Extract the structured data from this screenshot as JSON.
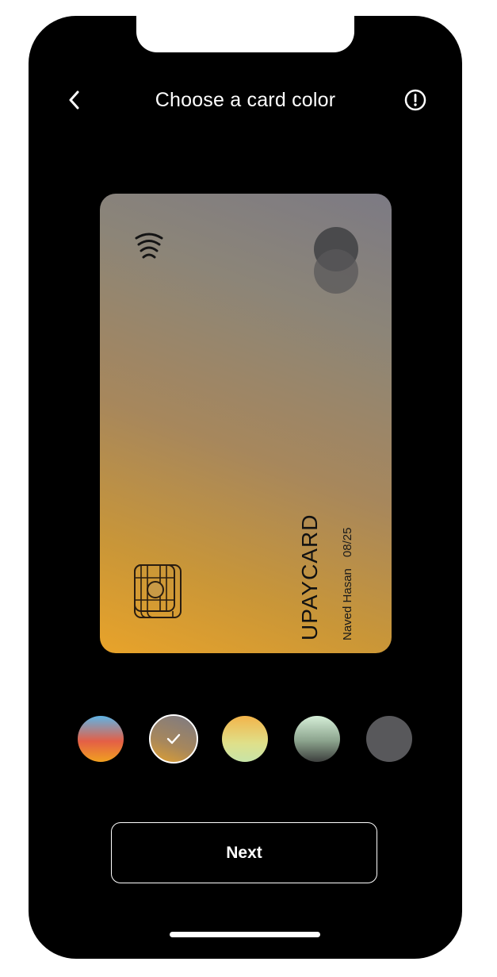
{
  "header": {
    "title": "Choose a card color",
    "back_icon": "chevron-left-icon",
    "info_icon": "info-circle-icon"
  },
  "card": {
    "brand": "UPAYCARD",
    "holder_name": "Naved Hasan",
    "expiry": "08/25",
    "contactless_icon": "contactless-icon",
    "network_logo": "card-network-logo",
    "chip_icon": "chip-icon",
    "gradient_colors": [
      "#7c7a84",
      "#a7875c",
      "#e8a32a"
    ]
  },
  "swatches": [
    {
      "name": "sunset",
      "colors": [
        "#5fb4e6",
        "#e45f46",
        "#f0a020"
      ],
      "selected": false
    },
    {
      "name": "bronze",
      "colors": [
        "#7c7a84",
        "#a7875c",
        "#e0a030"
      ],
      "selected": true
    },
    {
      "name": "lemon",
      "colors": [
        "#f3b44a",
        "#dfe08a",
        "#c8e4a8"
      ],
      "selected": false
    },
    {
      "name": "mint",
      "colors": [
        "#d6efd8",
        "#8aa28c",
        "#3d3f3d"
      ],
      "selected": false
    },
    {
      "name": "graphite",
      "colors": [
        "#58585b"
      ],
      "selected": false
    }
  ],
  "actions": {
    "next_label": "Next"
  }
}
